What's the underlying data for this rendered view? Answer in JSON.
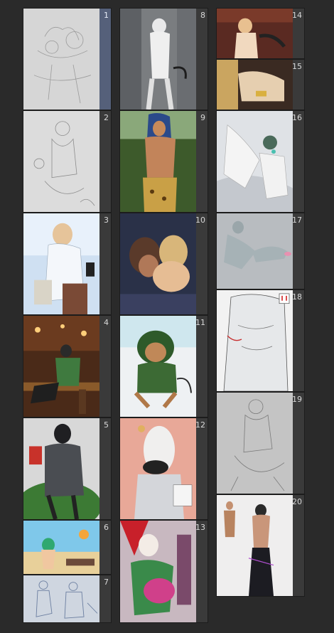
{
  "panel": {
    "selected_page": "1",
    "pages": [
      {
        "label": "1",
        "kind": "sketch"
      },
      {
        "label": "2",
        "kind": "sketch"
      },
      {
        "label": "3",
        "kind": "illustration"
      },
      {
        "label": "4",
        "kind": "illustration"
      },
      {
        "label": "5",
        "kind": "illustration"
      },
      {
        "label": "6",
        "kind": "illustration"
      },
      {
        "label": "7",
        "kind": "sketch"
      },
      {
        "label": "8",
        "kind": "illustration"
      },
      {
        "label": "9",
        "kind": "illustration"
      },
      {
        "label": "10",
        "kind": "illustration"
      },
      {
        "label": "11",
        "kind": "illustration"
      },
      {
        "label": "12",
        "kind": "illustration"
      },
      {
        "label": "13",
        "kind": "illustration"
      },
      {
        "label": "14",
        "kind": "illustration"
      },
      {
        "label": "15",
        "kind": "illustration"
      },
      {
        "label": "16",
        "kind": "illustration"
      },
      {
        "label": "17",
        "kind": "illustration"
      },
      {
        "label": "18",
        "kind": "illustration"
      },
      {
        "label": "19",
        "kind": "sketch"
      },
      {
        "label": "20",
        "kind": "illustration"
      }
    ]
  }
}
